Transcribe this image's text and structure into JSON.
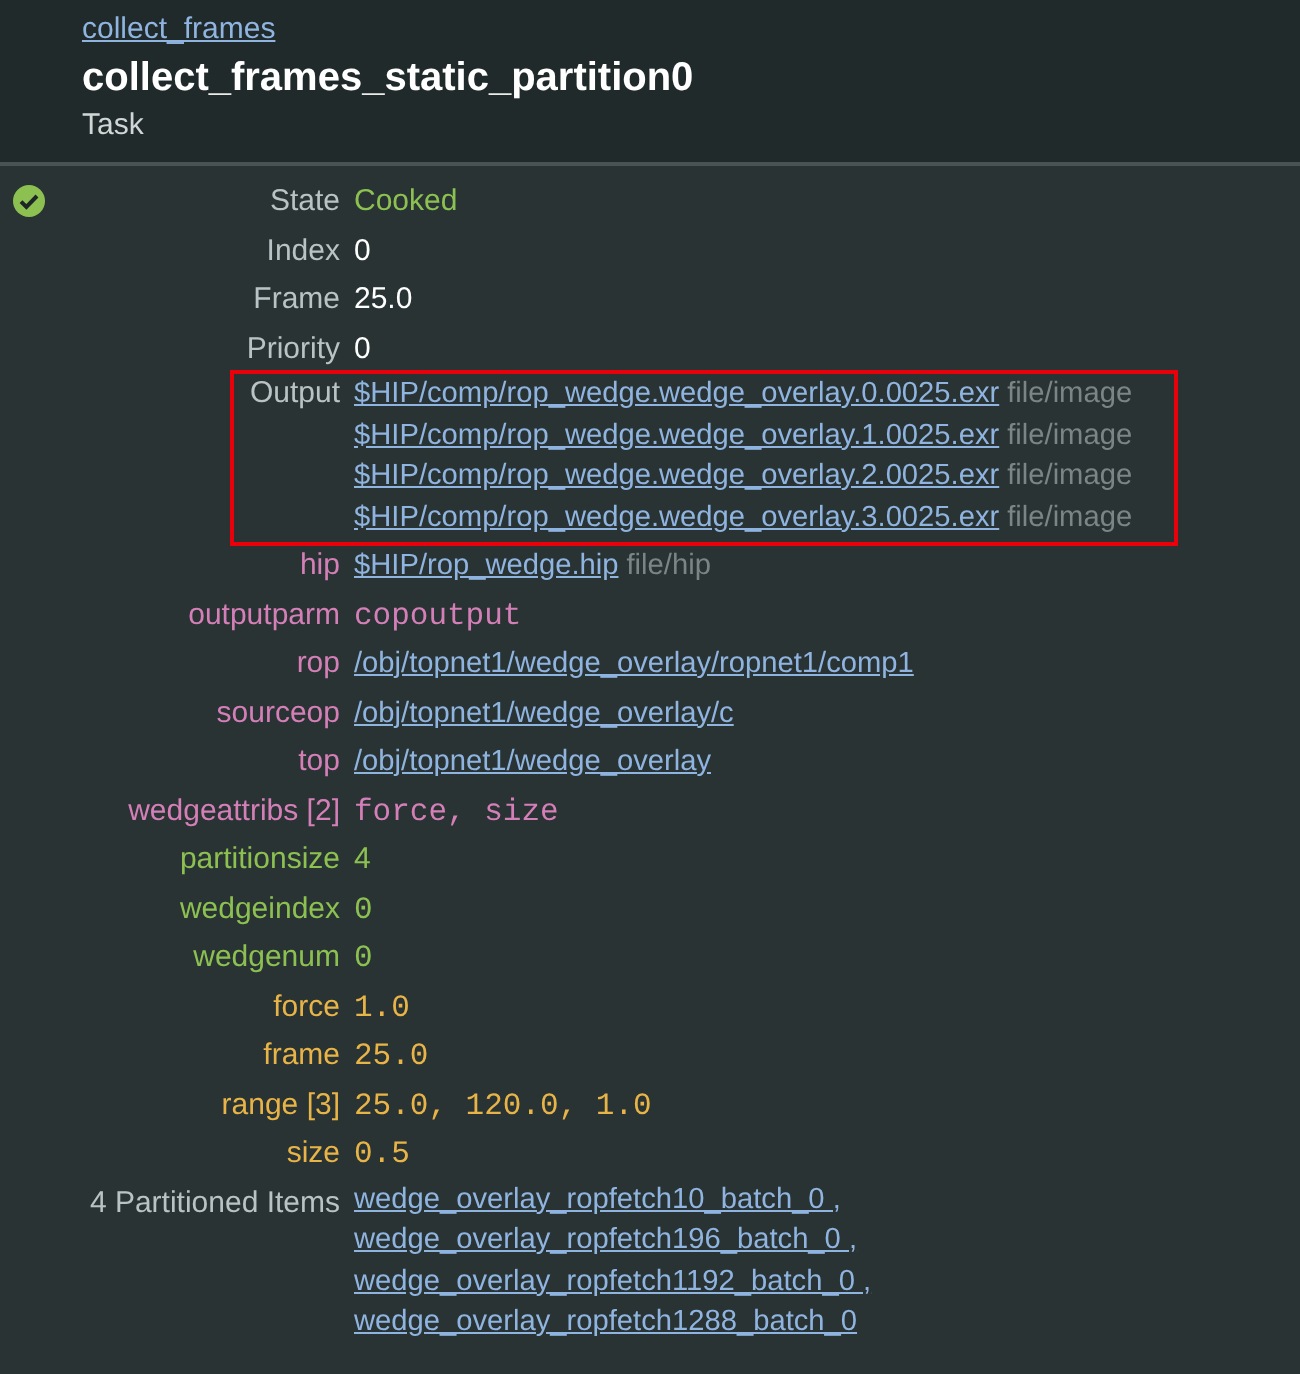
{
  "header": {
    "parent_link": "collect_frames",
    "title": "collect_frames_static_partition0",
    "subtitle": "Task"
  },
  "rows": [
    {
      "label": "State",
      "color": "#b9c2c4",
      "kind": "status",
      "value": "Cooked"
    },
    {
      "label": "Index",
      "color": "#b9c2c4",
      "kind": "text",
      "value": "0"
    },
    {
      "label": "Frame",
      "color": "#b9c2c4",
      "kind": "text",
      "value": "25.0"
    },
    {
      "label": "Priority",
      "color": "#b9c2c4",
      "kind": "text",
      "value": "0"
    },
    {
      "label": "Output",
      "color": "#b9c2c4",
      "kind": "files",
      "highlighted": true,
      "files": [
        {
          "path": "$HIP/comp/rop_wedge.wedge_overlay.0.0025.exr",
          "tag": "file/image"
        },
        {
          "path": "$HIP/comp/rop_wedge.wedge_overlay.1.0025.exr",
          "tag": "file/image"
        },
        {
          "path": "$HIP/comp/rop_wedge.wedge_overlay.2.0025.exr",
          "tag": "file/image"
        },
        {
          "path": "$HIP/comp/rop_wedge.wedge_overlay.3.0025.exr",
          "tag": "file/image"
        }
      ]
    },
    {
      "label": "hip",
      "color": "#d47fb8",
      "kind": "files",
      "highlighted": false,
      "files": [
        {
          "path": "$HIP/rop_wedge.hip",
          "tag": "file/hip"
        }
      ]
    },
    {
      "label": "outputparm",
      "color": "#d47fb8",
      "kind": "mono",
      "value": "copoutput"
    },
    {
      "label": "rop",
      "color": "#d47fb8",
      "kind": "links",
      "links": [
        "/obj/topnet1/wedge_overlay/ropnet1/comp1"
      ]
    },
    {
      "label": "sourceop",
      "color": "#d47fb8",
      "kind": "links",
      "links": [
        "/obj/topnet1/wedge_overlay/c"
      ]
    },
    {
      "label": "top",
      "color": "#d47fb8",
      "kind": "links",
      "links": [
        "/obj/topnet1/wedge_overlay"
      ]
    },
    {
      "label": "wedgeattribs [2]",
      "color": "#d47fb8",
      "kind": "mono",
      "value": "force, size"
    },
    {
      "label": "partitionsize",
      "color": "#8cc152",
      "kind": "number",
      "value": "4"
    },
    {
      "label": "wedgeindex",
      "color": "#8cc152",
      "kind": "mono",
      "value": "0"
    },
    {
      "label": "wedgenum",
      "color": "#8cc152",
      "kind": "mono",
      "value": "0"
    },
    {
      "label": "force",
      "color": "#e8b447",
      "kind": "mono",
      "value": "1.0"
    },
    {
      "label": "frame",
      "color": "#e8b447",
      "kind": "mono",
      "value": "25.0"
    },
    {
      "label": "range [3]",
      "color": "#e8b447",
      "kind": "mono",
      "value": "25.0, 120.0, 1.0"
    },
    {
      "label": "size",
      "color": "#e8b447",
      "kind": "mono",
      "value": "0.5"
    },
    {
      "label": "4 Partitioned Items",
      "color": "#b9c2c4",
      "kind": "links",
      "links": [
        "wedge_overlay_ropfetch10_batch_0 ,",
        "wedge_overlay_ropfetch196_batch_0 ,",
        "wedge_overlay_ropfetch1192_batch_0 ,",
        "wedge_overlay_ropfetch1288_batch_0"
      ]
    }
  ]
}
